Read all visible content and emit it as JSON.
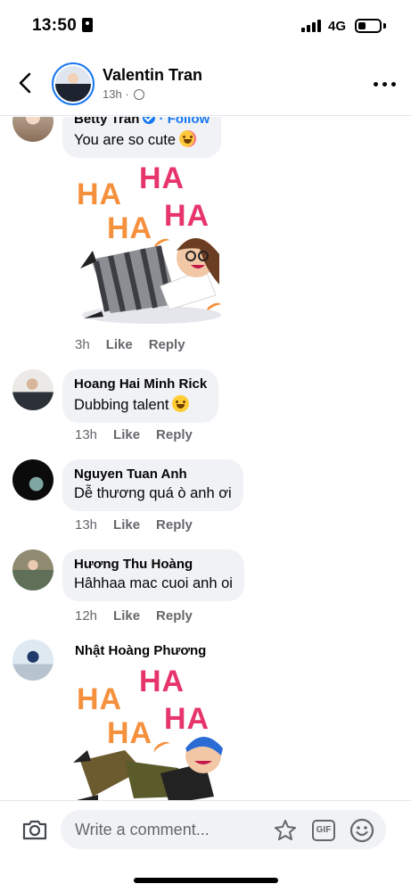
{
  "status_bar": {
    "time": "13:50",
    "network": "4G",
    "battery_level": 0.35
  },
  "header": {
    "page_name": "Valentin Tran",
    "post_age": "13h",
    "privacy_icon": "globe-icon"
  },
  "comments": [
    {
      "author": "Betty Tran",
      "verified": true,
      "follow_label": "· Follow",
      "text": "You are so cute",
      "emoji": "smiling-face-with-hearts",
      "sticker": "ha-ha-laughing-avatar",
      "time": "3h",
      "like_label": "Like",
      "reply_label": "Reply"
    },
    {
      "author": "Hoang Hai Minh Rick",
      "text": "Dubbing talent",
      "emoji": "grinning-sweat-face",
      "time": "13h",
      "like_label": "Like",
      "reply_label": "Reply"
    },
    {
      "author": "Nguyen Tuan Anh",
      "text": "Dễ thương quá ò anh ơi",
      "time": "13h",
      "like_label": "Like",
      "reply_label": "Reply"
    },
    {
      "author": "Hương Thu Hoàng",
      "text": "Hâhhaa mac cuoi anh oi",
      "time": "12h",
      "like_label": "Like",
      "reply_label": "Reply"
    },
    {
      "author": "Nhật Hoàng Phương",
      "sticker": "ha-ha-laughing-avatar"
    }
  ],
  "sticker_text": {
    "ha": "HA"
  },
  "composer": {
    "placeholder": "Write a comment...",
    "gif_label": "GIF"
  },
  "colors": {
    "accent": "#1877f2",
    "bubble_bg": "#f0f2f5",
    "secondary_text": "#65676b",
    "ha_orange": "#f5903d",
    "ha_pink": "#e7356c"
  }
}
